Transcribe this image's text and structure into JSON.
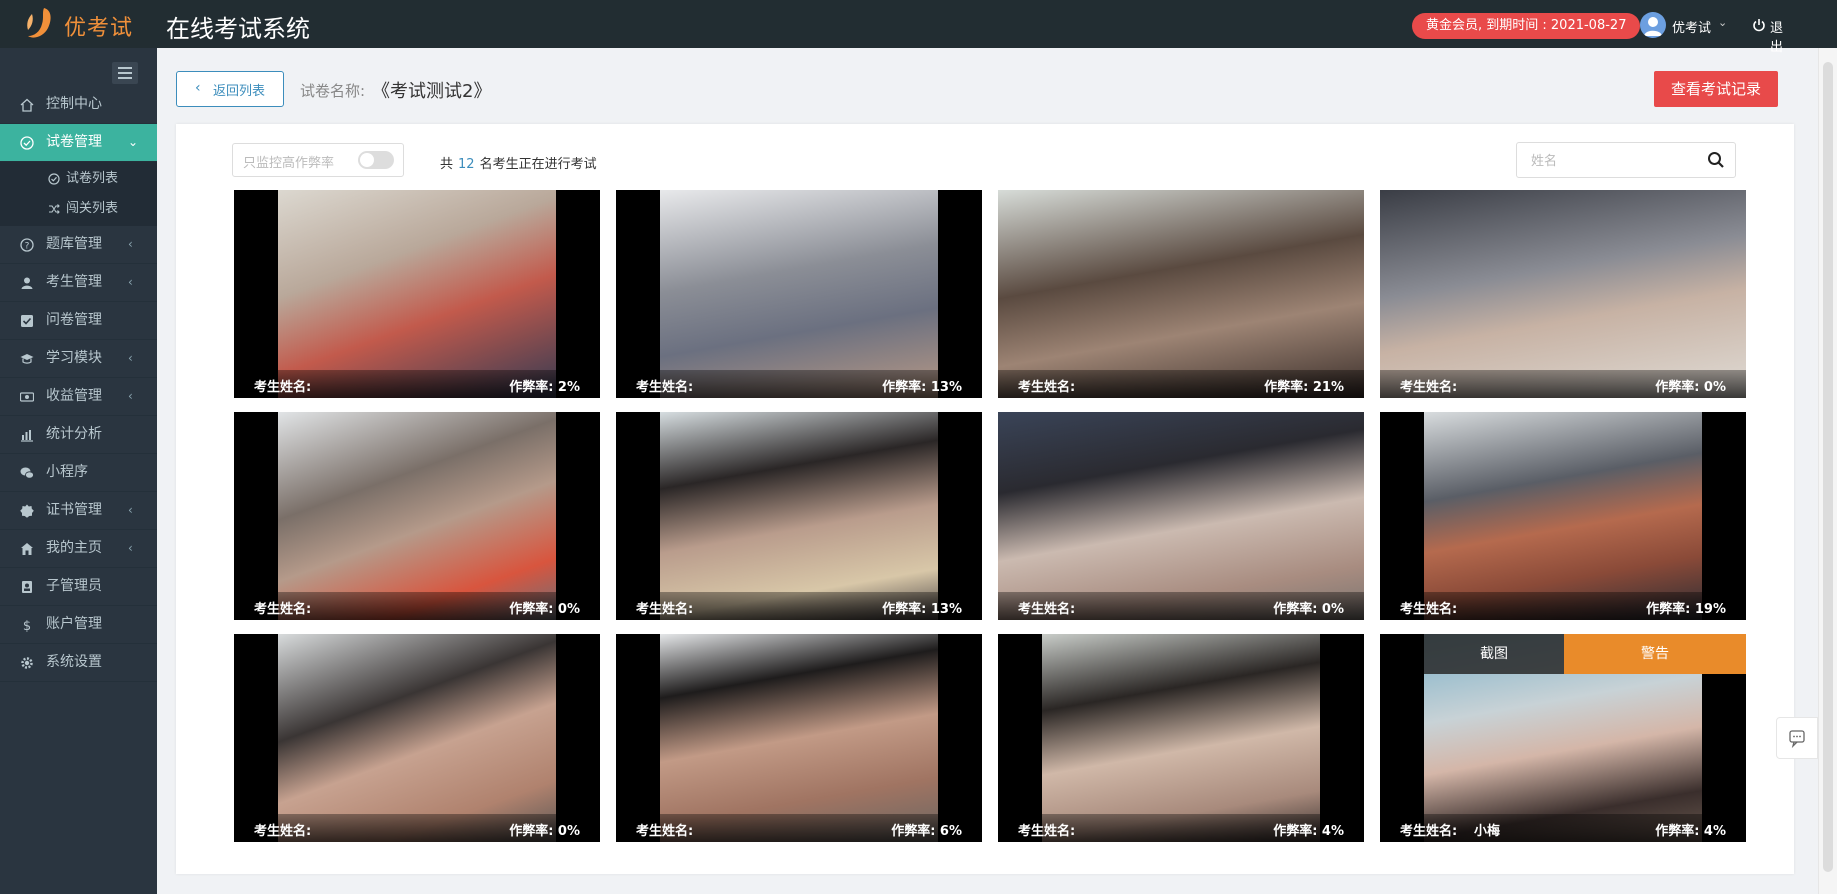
{
  "header": {
    "logo_text": "优考试",
    "system_title": "在线考试系统",
    "vip_badge": "黄金会员, 到期时间 : 2021-08-27",
    "user_name": "优考试",
    "logout_label": "退出"
  },
  "sidebar": {
    "items": [
      {
        "label": "控制中心",
        "icon": "home-icon",
        "has_arrow": false
      },
      {
        "label": "试卷管理",
        "icon": "check-circle-icon",
        "has_arrow": true,
        "active": true
      },
      {
        "label": "题库管理",
        "icon": "question-circle-icon",
        "has_arrow": true
      },
      {
        "label": "考生管理",
        "icon": "user-icon",
        "has_arrow": true
      },
      {
        "label": "问卷管理",
        "icon": "checkbox-icon",
        "has_arrow": false
      },
      {
        "label": "学习模块",
        "icon": "graduation-cap-icon",
        "has_arrow": true
      },
      {
        "label": "收益管理",
        "icon": "money-icon",
        "has_arrow": true
      },
      {
        "label": "统计分析",
        "icon": "bar-chart-icon",
        "has_arrow": false
      },
      {
        "label": "小程序",
        "icon": "wechat-icon",
        "has_arrow": false
      },
      {
        "label": "证书管理",
        "icon": "certificate-icon",
        "has_arrow": true
      },
      {
        "label": "我的主页",
        "icon": "home-page-icon",
        "has_arrow": true
      },
      {
        "label": "子管理员",
        "icon": "sub-admin-icon",
        "has_arrow": false
      },
      {
        "label": "账户管理",
        "icon": "dollar-icon",
        "has_arrow": false
      },
      {
        "label": "系统设置",
        "icon": "gear-icon",
        "has_arrow": false
      }
    ],
    "submenu": [
      {
        "label": "试卷列表",
        "icon": "check-circle-icon"
      },
      {
        "label": "闯关列表",
        "icon": "shuffle-icon"
      }
    ]
  },
  "toolbar": {
    "back_label": "返回列表",
    "paper_label": "试卷名称:",
    "paper_name": "《考试测试2》",
    "record_button": "查看考试记录"
  },
  "filter": {
    "toggle_label": "只监控高作弊率",
    "toggle_on": false,
    "count_prefix": "共",
    "count": "12",
    "count_suffix": "名考生正在进行考试",
    "search_placeholder": "姓名"
  },
  "cards": [
    {
      "name_label": "考生姓名:",
      "name": "",
      "rate": "作弊率: 2%"
    },
    {
      "name_label": "考生姓名:",
      "name": "",
      "rate": "作弊率: 13%"
    },
    {
      "name_label": "考生姓名:",
      "name": "",
      "rate": "作弊率: 21%"
    },
    {
      "name_label": "考生姓名:",
      "name": "",
      "rate": "作弊率: 0%"
    },
    {
      "name_label": "考生姓名:",
      "name": "",
      "rate": "作弊率: 0%"
    },
    {
      "name_label": "考生姓名:",
      "name": "",
      "rate": "作弊率: 13%"
    },
    {
      "name_label": "考生姓名:",
      "name": "",
      "rate": "作弊率: 0%"
    },
    {
      "name_label": "考生姓名:",
      "name": "",
      "rate": "作弊率: 19%"
    },
    {
      "name_label": "考生姓名:",
      "name": "",
      "rate": "作弊率: 0%"
    },
    {
      "name_label": "考生姓名:",
      "name": "",
      "rate": "作弊率: 6%"
    },
    {
      "name_label": "考生姓名:",
      "name": "",
      "rate": "作弊率: 4%"
    },
    {
      "name_label": "考生姓名:",
      "name": "小梅",
      "rate": "作弊率: 4%",
      "screenshot_label": "截图",
      "warn_label": "警告"
    }
  ],
  "colors": {
    "topbar": "#222d32",
    "sidebar": "#2a3540",
    "active": "#3cb39f",
    "accent": "#3c8dbc",
    "danger": "#e84a4a",
    "warn": "#e98b2a"
  }
}
